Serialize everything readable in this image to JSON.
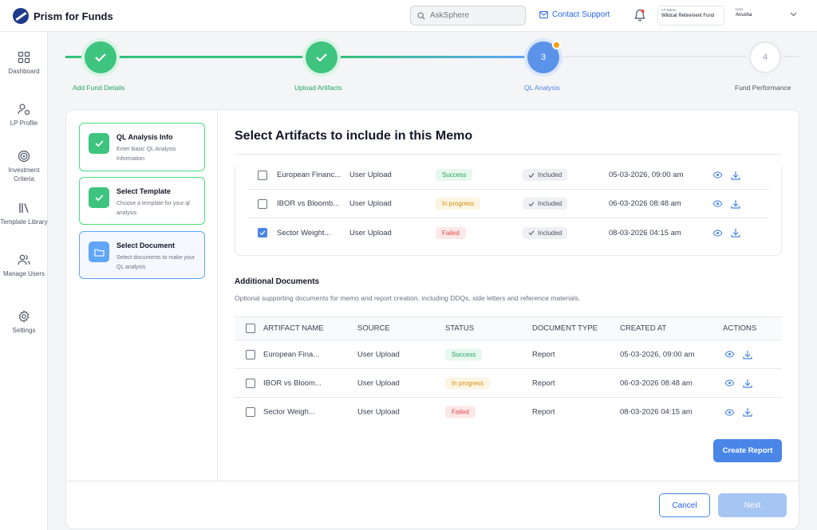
{
  "app": {
    "name": "Prism for Funds"
  },
  "header": {
    "search_placeholder": "AskSphere",
    "support_label": "Contact Support",
    "lp_label": "LP Name",
    "lp_value": "Wildcat Retirement Fund",
    "user_label": "User",
    "user_value": "Anusha"
  },
  "sidebar": {
    "items": [
      {
        "label": "Dashboard",
        "icon": "grid-icon"
      },
      {
        "label": "LP Profile",
        "icon": "user-profile-icon"
      },
      {
        "label": "Investment Criteria",
        "icon": "target-icon"
      },
      {
        "label": "Template Library",
        "icon": "library-icon"
      },
      {
        "label": "Manage Users",
        "icon": "users-icon"
      },
      {
        "label": "Settings",
        "icon": "gear-icon"
      }
    ]
  },
  "stepper": {
    "steps": [
      {
        "label": "Add Fund Details",
        "state": "done"
      },
      {
        "label": "Upload Artifacts",
        "state": "done"
      },
      {
        "label": "QL Analysis",
        "number": "3",
        "state": "active"
      },
      {
        "label": "Fund Performance",
        "number": "4",
        "state": "todo"
      }
    ]
  },
  "substeps": [
    {
      "title": "QL Analysis Info",
      "desc": "Enter Basic QL Analysis Information",
      "state": "done"
    },
    {
      "title": "Select Template",
      "desc": "Choose a template for your ql analysis",
      "state": "done"
    },
    {
      "title": "Select Document",
      "desc": "Select documents to make your QL analysis",
      "state": "active"
    }
  ],
  "memo": {
    "title": "Select Artifacts to include in this Memo",
    "included_label": "Included",
    "rows": [
      {
        "name": "European Financ...",
        "source": "User Upload",
        "status": "Success",
        "status_type": "success",
        "created": "05-03-2026, 09:00 am",
        "checked": false
      },
      {
        "name": "IBOR vs Bloomb...",
        "source": "User Upload",
        "status": "In progress",
        "status_type": "progress",
        "created": "06-03-2026 08:48 am",
        "checked": false
      },
      {
        "name": "Sector Weight...",
        "source": "User Upload",
        "status": "Failed",
        "status_type": "failed",
        "created": "08-03-2026 04:15 am",
        "checked": true
      }
    ]
  },
  "additional": {
    "title": "Additional Documents",
    "desc": "Optional supporting documents for memo and report creation, including DDQs, side letters and reference materials.",
    "columns": [
      "ARTIFACT NAME",
      "SOURCE",
      "STATUS",
      "DOCUMENT TYPE",
      "CREATED AT",
      "ACTIONS"
    ],
    "rows": [
      {
        "name": "European Fina...",
        "source": "User Upload",
        "status": "Success",
        "status_type": "success",
        "type": "Report",
        "created": "05-03-2026, 09:00 am"
      },
      {
        "name": "IBOR vs Bloom...",
        "source": "User Upload",
        "status": "In progress",
        "status_type": "progress",
        "type": "Report",
        "created": "06-03-2026 08:48 am"
      },
      {
        "name": "Sector Weigh...",
        "source": "User Upload",
        "status": "Failed",
        "status_type": "failed",
        "type": "Report",
        "created": "08-03-2026 04:15 am"
      }
    ]
  },
  "buttons": {
    "create_report": "Create Report",
    "cancel": "Cancel",
    "next": "Next"
  },
  "colors": {
    "primary": "#4a86e8",
    "success": "#3ec47e",
    "warning": "#f59e0b",
    "danger": "#e04848"
  }
}
